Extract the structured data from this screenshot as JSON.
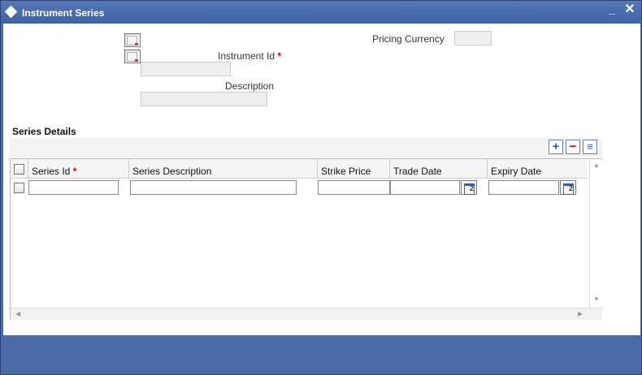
{
  "window": {
    "title": "Instrument Series",
    "minimize_label": "_",
    "close_label": "✕"
  },
  "form": {
    "pricing_currency_label": "Pricing Currency",
    "pricing_currency_value": "",
    "instrument_id_label": "Instrument Id",
    "instrument_id_value": "",
    "description_label": "Description",
    "description_value": "",
    "required_marker": "*"
  },
  "series_details": {
    "title": "Series Details",
    "toolbar": {
      "add_label": "+",
      "remove_label": "−",
      "view_label": "≡"
    },
    "columns": [
      "Series Id",
      "Series Description",
      "Strike Price",
      "Trade Date",
      "Expiry Date"
    ],
    "rows": [
      {
        "series_id": "",
        "series_description": "",
        "strike_price": "",
        "trade_date": "",
        "expiry_date": ""
      }
    ]
  },
  "colors": {
    "title_bar": "#4b6aa8",
    "required": "#d00000",
    "accent": "#3a5fa3"
  },
  "icons": [
    "document-icon",
    "calendar-icon",
    "add-row-icon",
    "remove-row-icon",
    "single-view-icon"
  ]
}
